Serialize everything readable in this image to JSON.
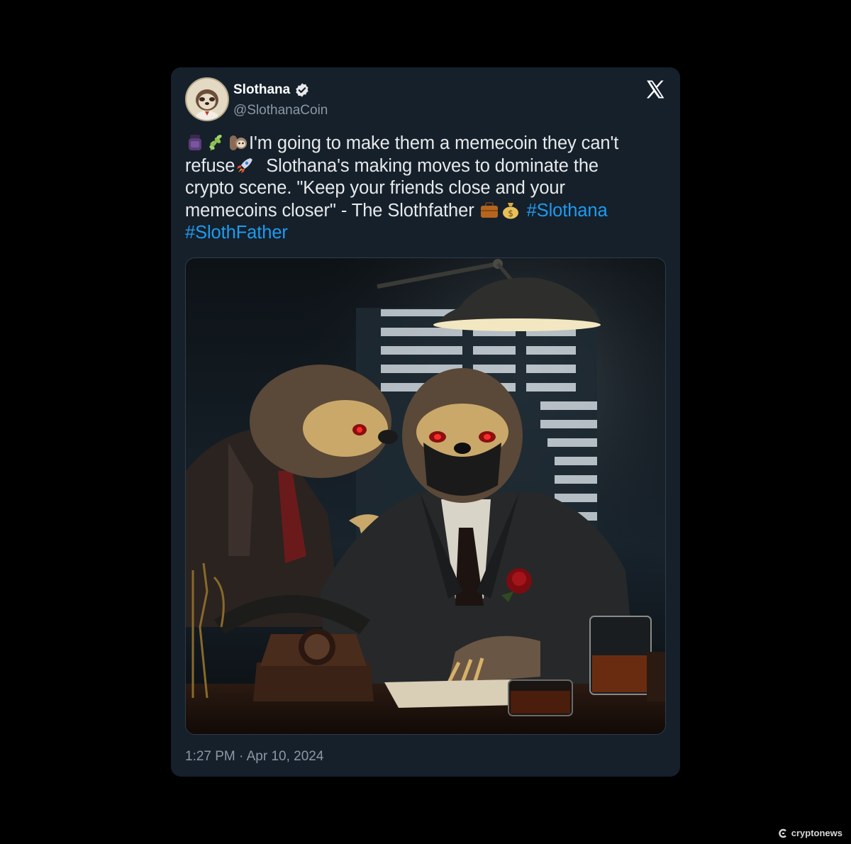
{
  "tweet": {
    "display_name": "Slothana",
    "handle": "@SlothanaCoin",
    "verified_icon": "verified-badge-icon",
    "platform_icon": "x-logo-icon",
    "text_line_1": "I'm going to make them a memecoin they can't",
    "text_refuse": "refuse",
    "text_line_2": "Slothana's making moves to dominate the",
    "text_line_3": "crypto scene. \"Keep your friends close and your",
    "text_line_4": "memecoins closer\" - The Slothfather",
    "hashtag_1": "#Slothana",
    "hashtag_2": "#SlothFather",
    "timestamp": "1:27 PM · Apr 10, 2024",
    "emojis": [
      "potion-icon",
      "herb-icon",
      "sloth-icon",
      "rocket-icon",
      "briefcase-icon",
      "money-bag-icon"
    ]
  },
  "media": {
    "description_icon": "slothfather-image"
  },
  "watermark": {
    "label": "cryptonews"
  },
  "colors": {
    "background": "#000000",
    "card": "#15202b",
    "text": "#e7e9ea",
    "muted": "#8b98a5",
    "link": "#1d9bf0"
  }
}
